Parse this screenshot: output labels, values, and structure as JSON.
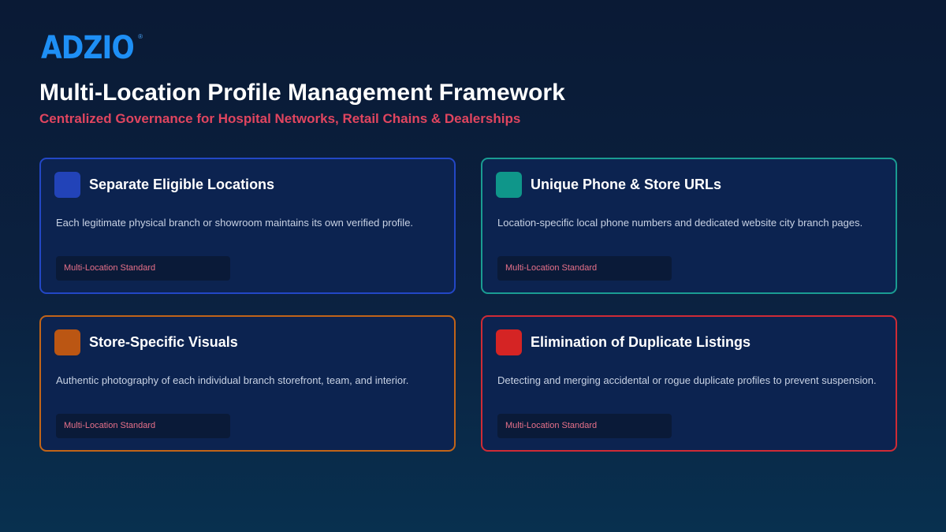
{
  "brand": {
    "logo_text": "ADZIO",
    "registered_mark": "®"
  },
  "header": {
    "title": "Multi-Location Profile Management Framework",
    "subtitle": "Centralized Governance for Hospital Networks, Retail Chains & Dealerships"
  },
  "cards": [
    {
      "title": "Separate Eligible Locations",
      "description": "Each legitimate physical branch or showroom maintains its own verified profile.",
      "tag": "Multi-Location Standard",
      "accent": "#2243b8"
    },
    {
      "title": "Unique Phone & Store URLs",
      "description": "Location-specific local phone numbers and dedicated website city branch pages.",
      "tag": "Multi-Location Standard",
      "accent": "#0f968a"
    },
    {
      "title": "Store-Specific Visuals",
      "description": "Authentic photography of each individual branch storefront, team, and interior.",
      "tag": "Multi-Location Standard",
      "accent": "#bb5613"
    },
    {
      "title": "Elimination of Duplicate Listings",
      "description": "Detecting and merging accidental or rogue duplicate profiles to prevent suspension.",
      "tag": "Multi-Location Standard",
      "accent": "#d52424"
    }
  ],
  "colors": {
    "background": "#0b2140",
    "card_background": "#0c2350",
    "subtitle": "#e0455f",
    "tag_text": "#e8718a",
    "logo": "#1e8ff5"
  }
}
